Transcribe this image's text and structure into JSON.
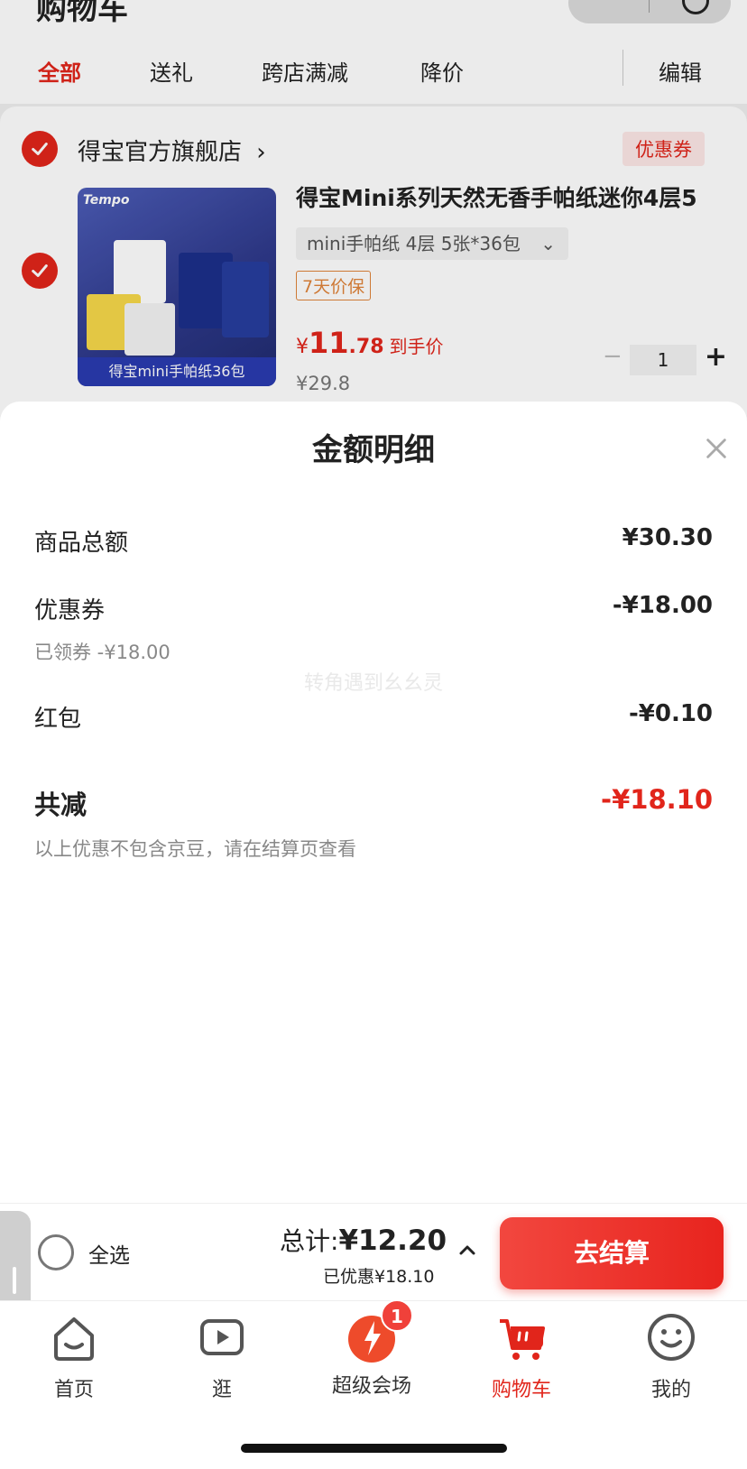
{
  "cart_header": {
    "title": "购物车",
    "tabs": [
      "全部",
      "送礼",
      "跨店满减",
      "降价"
    ],
    "edit_label": "编辑"
  },
  "shop": {
    "name": "得宝官方旗舰店",
    "chevron": "›",
    "coupon_label": "优惠券"
  },
  "product": {
    "image_brand": "Tempo",
    "image_caption": "得宝mini手帕纸36包",
    "title": "得宝Mini系列天然无香手帕纸迷你4层5",
    "spec": "mini手帕纸 4层 5张*36包",
    "guarantee": "7天价保",
    "price_symbol": "¥",
    "price_int": "11",
    "price_dec": ".78",
    "price_tip": "到手价",
    "original_price": "¥29.8",
    "quantity": "1"
  },
  "sheet": {
    "title": "金额明细",
    "rows": {
      "goods_total": {
        "label": "商品总额",
        "value": "¥30.30"
      },
      "coupon": {
        "label": "优惠券",
        "value": "-¥18.00",
        "sub": "已领券 -¥18.00"
      },
      "red_packet": {
        "label": "红包",
        "value": "-¥0.10"
      }
    },
    "watermark": "转角遇到幺幺灵",
    "total_reduce_label": "共减",
    "total_reduce_value": "-¥18.10",
    "note": "以上优惠不包含京豆，请在结算页查看"
  },
  "checkout": {
    "select_all": "全选",
    "total_prefix": "总计:",
    "total_amount": "¥12.20",
    "saved": "已优惠¥18.10",
    "button": "去结算"
  },
  "tabbar": {
    "items": [
      {
        "label": "首页",
        "icon": "home-icon"
      },
      {
        "label": "逛",
        "icon": "video-play-icon"
      },
      {
        "label": "超级会场",
        "icon": "super-venue-icon",
        "badge": "1"
      },
      {
        "label": "购物车",
        "icon": "cart-icon"
      },
      {
        "label": "我的",
        "icon": "smiley-face-icon"
      }
    ]
  },
  "colors": {
    "brand_red": "#e1251b",
    "guarantee_orange": "#e0843a"
  }
}
